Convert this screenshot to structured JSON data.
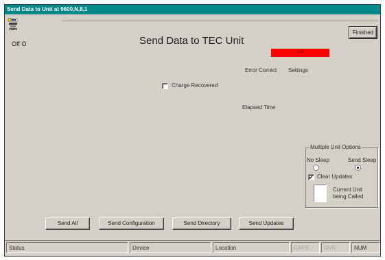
{
  "window": {
    "title": "Send Data to Unit at 9600,N,8,1"
  },
  "header": {
    "title": "Send Data to TEC Unit",
    "onoff_label": "Off  O",
    "finished_label": "Finished",
    "status_indicator": "Off"
  },
  "main": {
    "error_correct_label": "Error Correct",
    "settings_label": "Settings",
    "charge_recovered_label": "Charge Recovered",
    "elapsed_time_label": "Elapsed Time"
  },
  "multiple_unit_options": {
    "title": "Multiple Unit Options",
    "no_sleep_label": "No Sleep",
    "send_sleep_label": "Send Sleep",
    "clear_updates_label": "Clear Updates",
    "current_unit_label_line1": "Current Unit",
    "current_unit_label_line2": "being Called"
  },
  "buttons": {
    "send_all": "Send All",
    "send_configuration": "Send Configuration",
    "send_directory": "Send Directory",
    "send_updates": "Send Updates"
  },
  "statusbar": {
    "status": "Status",
    "device": "Device",
    "location": "Location",
    "caps": "CAPS",
    "ovr": "OVR",
    "num": "NUM"
  },
  "colors": {
    "titlebar": "#008a8a",
    "window_face": "#d4d0c8",
    "status_indicator": "#ff0000"
  }
}
